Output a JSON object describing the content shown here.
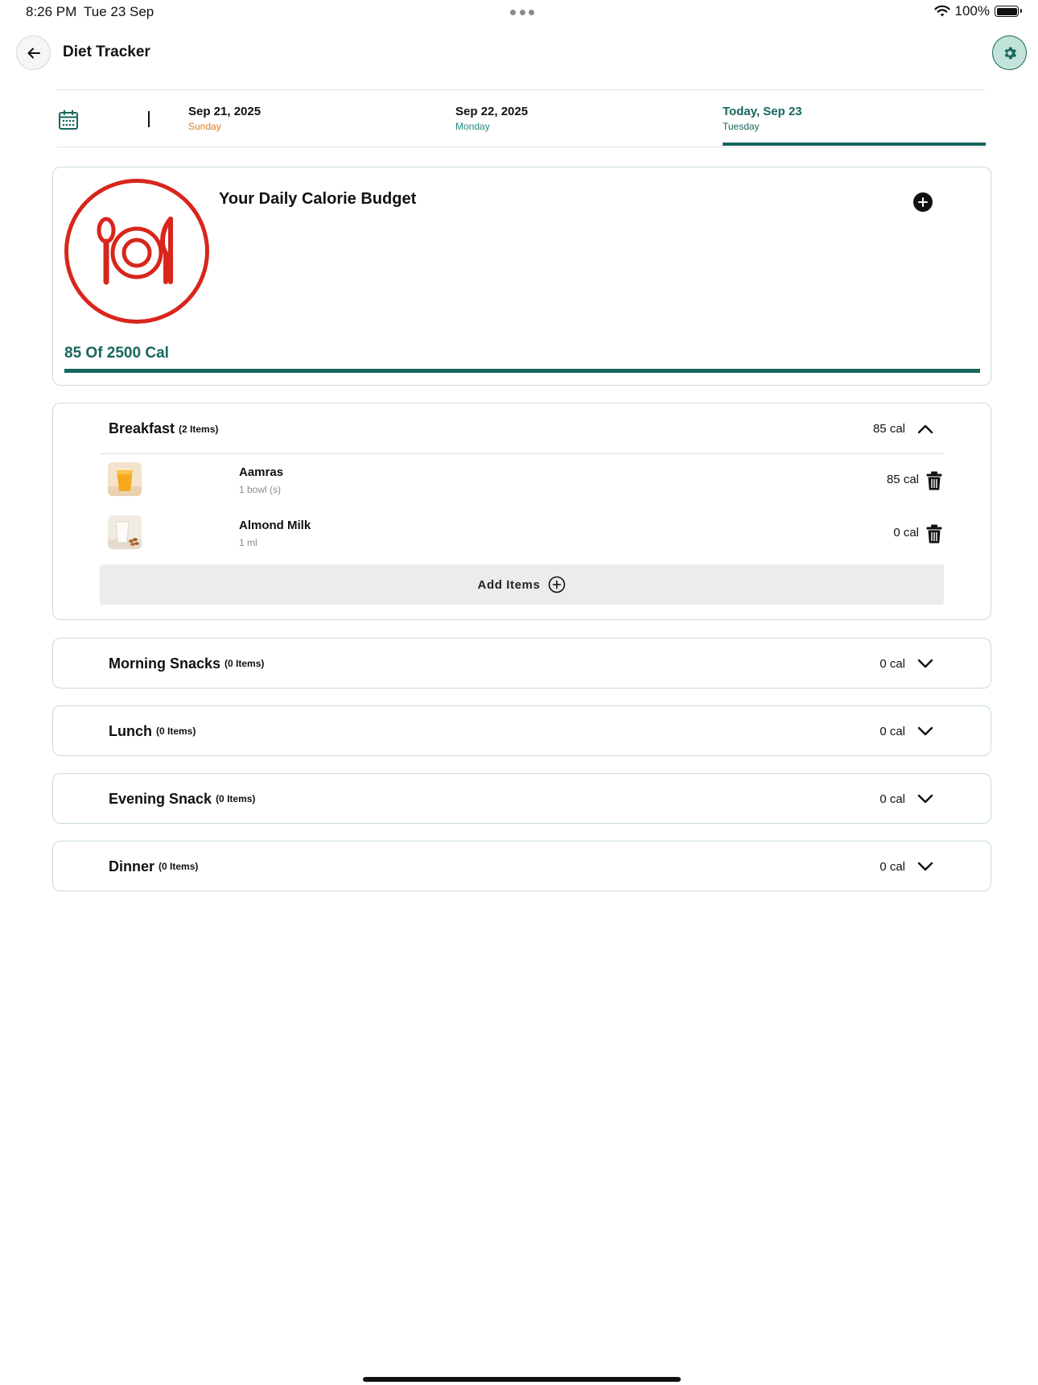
{
  "status_bar": {
    "time": "8:26 PM",
    "date": "Tue 23 Sep",
    "battery": "100%"
  },
  "header": {
    "title": "Diet Tracker"
  },
  "dates": [
    {
      "label": "Sep 21, 2025",
      "day": "Sunday"
    },
    {
      "label": "Sep 22, 2025",
      "day": "Monday"
    },
    {
      "label": "Today, Sep 23",
      "day": "Tuesday",
      "selected": true
    }
  ],
  "budget": {
    "title": "Your Daily Calorie Budget",
    "summary": "85 Of 2500 Cal",
    "consumed": 85,
    "goal": 2500,
    "progress_fill_fraction": 1.0
  },
  "meals": {
    "breakfast": {
      "name": "Breakfast",
      "count": "(2 Items)",
      "cal": "85 cal",
      "expanded": true,
      "items": [
        {
          "name": "Aamras",
          "qty": "1 bowl (s)",
          "cal": "85 cal"
        },
        {
          "name": "Almond Milk",
          "qty": "1 ml",
          "cal": "0 cal"
        }
      ],
      "add_label": "Add Items"
    },
    "morning_snacks": {
      "name": "Morning Snacks",
      "count": "(0 Items)",
      "cal": "0 cal"
    },
    "lunch": {
      "name": "Lunch",
      "count": "(0 Items)",
      "cal": "0 cal"
    },
    "evening_snack": {
      "name": "Evening Snack",
      "count": "(0 Items)",
      "cal": "0 cal"
    },
    "dinner": {
      "name": "Dinner",
      "count": "(0 Items)",
      "cal": "0 cal"
    }
  },
  "colors": {
    "primary": "#16675c",
    "accent_red": "#d8261d",
    "sunday": "#e07b1f",
    "weekday": "#1f8a7c"
  }
}
